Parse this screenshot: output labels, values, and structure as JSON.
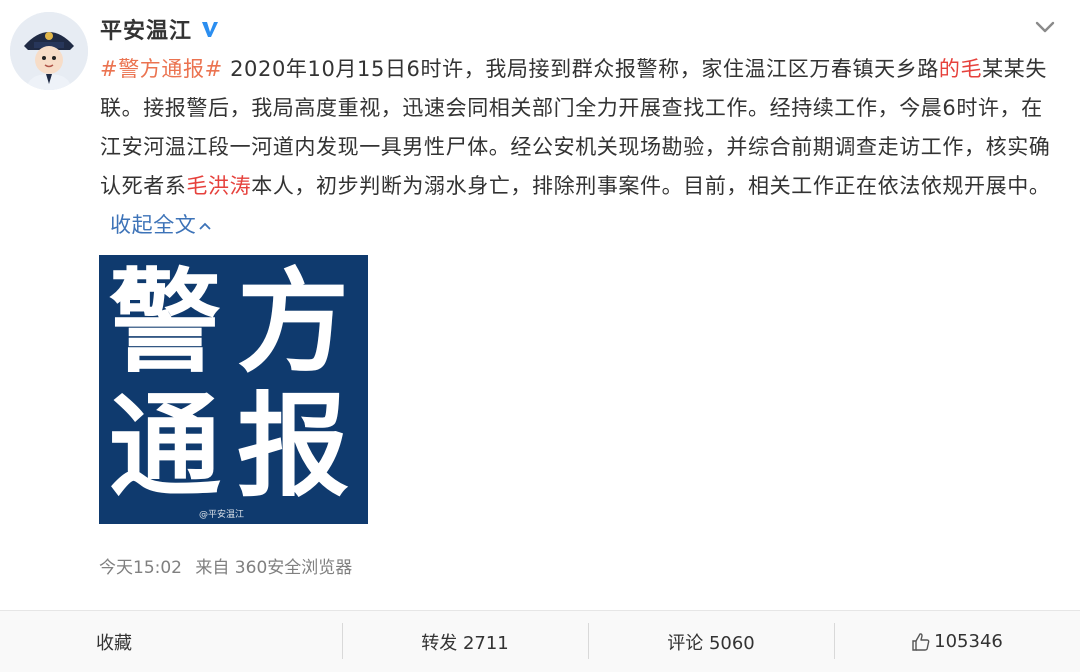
{
  "user": {
    "name": "平安温江",
    "verified": true
  },
  "post": {
    "segments": [
      {
        "text": "#警方通报#",
        "kind": "topic"
      },
      {
        "text": " 2020年10月15日6时许，我局接到群众报警称，家住温江区万春镇天乡路",
        "kind": "text"
      },
      {
        "text": "的毛",
        "kind": "highlight"
      },
      {
        "text": "某某失联。接报警后，我局高度重视，迅速会同相关部门全力开展查找工作。经持续工作，今晨6时许，在江安河温江段一河道内发现一具男性尸体。经公安机关现场勘验，并综合前期调查走访工作，核实确认死者系",
        "kind": "text"
      },
      {
        "text": "毛洪涛",
        "kind": "highlight"
      },
      {
        "text": "本人，初步判断为溺水身亡，排除刑事案件。目前，相关工作正在依法依规开展中。",
        "kind": "text"
      }
    ],
    "collapse_label": "收起全文",
    "image": {
      "chars": [
        "警",
        "方",
        "通",
        "报"
      ],
      "watermark": "@平安温江"
    },
    "time": "今天15:02",
    "source": "来自 360安全浏览器"
  },
  "actions": {
    "favorite": "收藏",
    "repost": "转发 2711",
    "comment": "评论 5060",
    "like": "105346"
  },
  "colors": {
    "topic": "#eb7350",
    "highlight": "#e6413c",
    "link": "#3d73b8",
    "poster_bg": "#0f3a6e"
  },
  "icons": [
    "police-avatar",
    "verified-icon",
    "chevron-down-icon",
    "chevron-up-icon",
    "thumbs-up-icon"
  ]
}
